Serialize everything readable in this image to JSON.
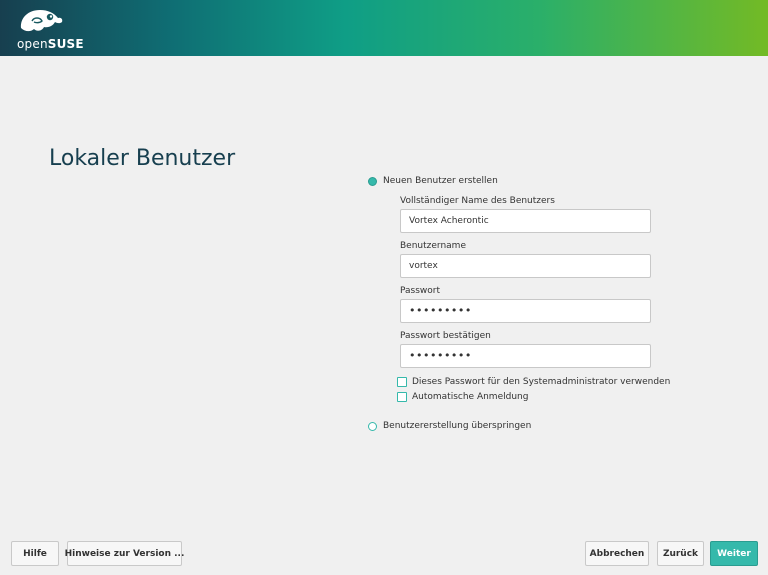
{
  "brand": {
    "logo_text_thin": "open",
    "logo_text_bold": "SUSE",
    "accent": "#35b9ab",
    "title_color": "#173f4f"
  },
  "page": {
    "title": "Lokaler Benutzer"
  },
  "form": {
    "create_option": "Neuen Benutzer erstellen",
    "fullname_label": "Vollständiger Name des Benutzers",
    "fullname_value": "Vortex Acherontic",
    "username_label": "Benutzername",
    "username_value": "vortex",
    "password_label": "Passwort",
    "password_value": "•••••••••",
    "confirm_label": "Passwort bestätigen",
    "confirm_value": "•••••••••",
    "admin_checkbox": "Dieses Passwort für den Systemadministrator verwenden",
    "autologin_checkbox": "Automatische Anmeldung",
    "skip_option": "Benutzererstellung überspringen"
  },
  "buttons": {
    "help": "Hilfe",
    "release_notes": "Hinweise zur Version ...",
    "abort": "Abbrechen",
    "back": "Zurück",
    "next": "Weiter"
  }
}
